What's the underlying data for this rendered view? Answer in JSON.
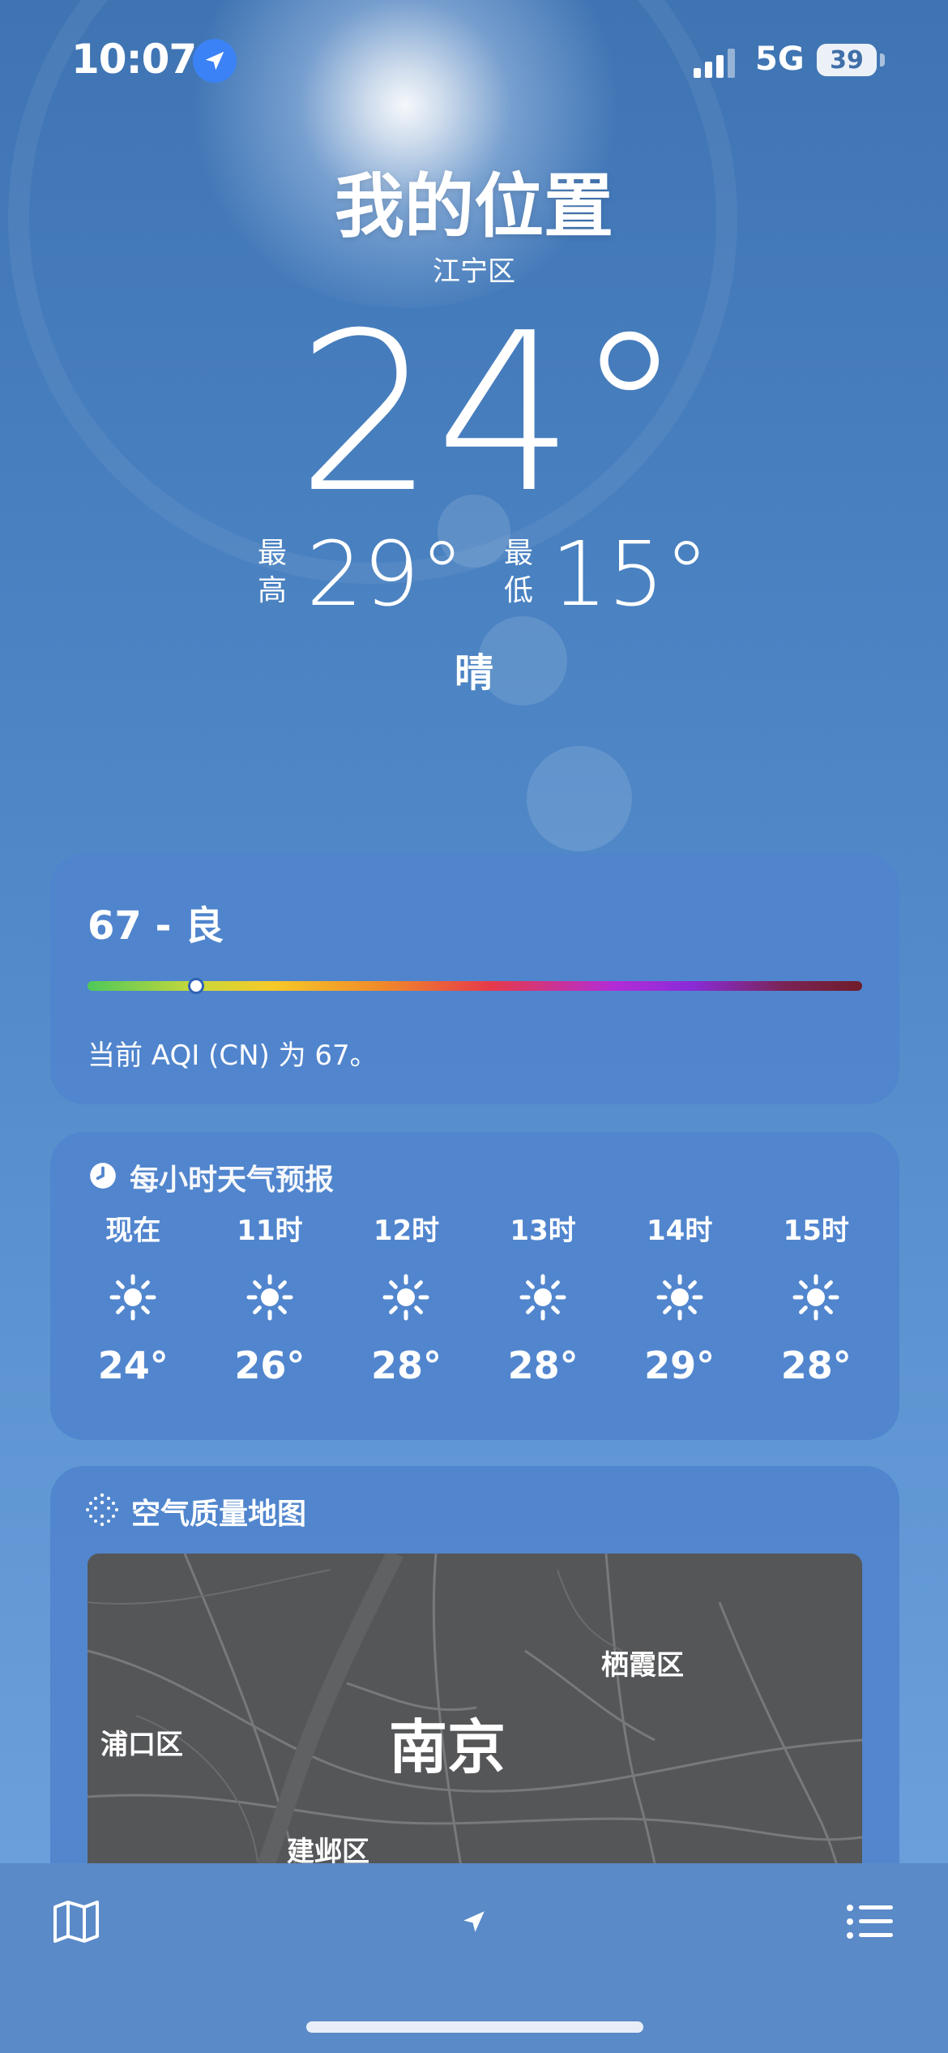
{
  "status_bar": {
    "time": "10:07",
    "network": "5G",
    "battery": "39",
    "location_icon": "location-arrow-icon",
    "signal_icon": "cellular-signal-icon"
  },
  "header": {
    "location": "我的位置",
    "district": "江宁区",
    "temperature": "24°",
    "high_label": "最高",
    "high_value": "29°",
    "low_label": "最低",
    "low_value": "15°",
    "condition": "晴"
  },
  "aqi_card": {
    "title": "67 - 良",
    "description": "当前 AQI (CN) 为 67。",
    "value": 67,
    "scale_fraction": 0.14
  },
  "hourly_card": {
    "title": "每小时天气预报",
    "icon": "clock-icon",
    "hours": [
      {
        "label": "现在",
        "icon": "sun-icon",
        "temp": "24°"
      },
      {
        "label": "11时",
        "icon": "sun-icon",
        "temp": "26°"
      },
      {
        "label": "12时",
        "icon": "sun-icon",
        "temp": "28°"
      },
      {
        "label": "13时",
        "icon": "sun-icon",
        "temp": "28°"
      },
      {
        "label": "14时",
        "icon": "sun-icon",
        "temp": "29°"
      },
      {
        "label": "15时",
        "icon": "sun-icon",
        "temp": "28°"
      }
    ]
  },
  "map_card": {
    "title": "空气质量地图",
    "icon": "dotted-grid-icon",
    "city": "南京",
    "districts": [
      "栖霞区",
      "浦口区",
      "建邺区"
    ]
  },
  "tab_bar": {
    "map_icon": "map-icon",
    "location_icon": "location-arrow-icon",
    "list_icon": "list-icon"
  },
  "colors": {
    "sky_top": "#3f74b3",
    "sky_bottom": "#6ea3dd",
    "card": "#5084cd",
    "map_bg": "#555658",
    "location_dot": "#3b82f6"
  }
}
